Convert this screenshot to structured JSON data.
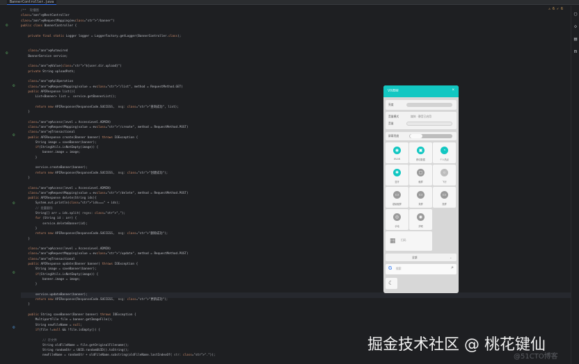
{
  "editor": {
    "tab_label": "BannerController.java",
    "status_text": "⚠ 6  ✓ 6",
    "code_lines": [
      "/**  轮播图",
      "@RestController",
      "@RequestMapping(⊕∨\"/banner\")",
      "public class BannerController {",
      "",
      "    private final static Logger logger = LoggerFactory.getLogger(BannerController.class);",
      "",
      "",
      "    @Autowired",
      "    BannerService service;",
      "",
      "    @Value(\"${user.dir.upload}\")",
      "    private String uploadPath;",
      "",
      "    @ApiOperation",
      "    @RequestMapping(value = ⊕∨\"/list\", method = RequestMethod.GET)",
      "    public APIResponse list(){",
      "        List<Banner> list =  service.getBannerList();",
      "",
      "        return new APIResponse(ResponseCode.SUCCESS,  msg: \"查询成功\", list);",
      "    }",
      "",
      "    @Access(level = AccessLevel.ADMIN)",
      "    @RequestMapping(value = ⊕∨\"/create\", method = RequestMethod.POST)",
      "    @Transactional",
      "    public APIResponse create(Banner banner) throws IOException {",
      "        String image = saveBanner(banner);",
      "        if(StringUtils.isNotEmpty(image)) {",
      "            banner.image = image;",
      "        }",
      "",
      "        service.createBanner(banner);",
      "        return new APIResponse(ResponseCode.SUCCESS,  msg: \"创建成功\");",
      "    }",
      "",
      "    @Access(level = AccessLevel.ADMIN)",
      "    @RequestMapping(value = ⊕∨\"/delete\", method = RequestMethod.POST)",
      "    public APIResponse delete(String ids){",
      "        System.out.println(\"ids===\" + ids);",
      "        // 批量删除",
      "        String[] arr = ids.split( regex: \",\");",
      "        for (String id : arr) {",
      "            service.deleteBanner(id);",
      "        }",
      "        return new APIResponse(ResponseCode.SUCCESS,  msg: \"删除成功\");",
      "    }",
      "",
      "    @Access(level = AccessLevel.ADMIN)",
      "    @RequestMapping(value = ⊕∨\"/update\", method = RequestMethod.POST)",
      "    @Transactional",
      "    public APIResponse update(Banner banner) throws IOException {",
      "        String image = saveBanner(banner);",
      "        if(StringUtils.isNotEmpty(image)) {",
      "            banner.image = image;",
      "        }",
      "",
      "        service.updateBanner(banner);",
      "        return new APIResponse(ResponseCode.SUCCESS,  msg: \"更新成功\");",
      "    }",
      "",
      "    public String saveBanner(Banner banner) throws IOException {",
      "        MultipartFile file = banner.getImageFile();",
      "        String newFileName = null;",
      "        if(file !=null && !file.isEmpty()) {",
      "",
      "            // 存文件",
      "            String oldFileName = file.getOriginalFilename();",
      "            String randomStr = UUID.randomUUID().toString();",
      "            newFileName = randomStr + oldFileName.substring(oldFileName.lastIndexOf( str: \".\"));"
    ]
  },
  "phone": {
    "title": "VIVBM",
    "close": "×",
    "row1_label": "亮度",
    "row2_label": "音量模式",
    "row2_value": "媒体 · 静音已启用",
    "row3_label": "音量",
    "row4_label": "屏幕亮度",
    "tiles": [
      {
        "label": "WLAN",
        "icon": "◉",
        "color": "#12c7c2"
      },
      {
        "label": "移动数据",
        "icon": "▣",
        "color": "#12c7c2"
      },
      {
        "label": "个人热点",
        "icon": "◔",
        "color": "#12c7c2"
      },
      {
        "label": "蓝牙",
        "icon": "✱",
        "color": "#12c7c2"
      },
      {
        "label": "截屏",
        "icon": "▢",
        "color": "#9a9a9a"
      },
      {
        "label": "飞行",
        "icon": "○",
        "color": "#bdbdbd"
      },
      {
        "label": "超级截屏",
        "icon": "▭",
        "color": "#9a9a9a"
      },
      {
        "label": "录屏",
        "icon": "▭",
        "color": "#9a9a9a"
      },
      {
        "label": "投屏",
        "icon": "▭",
        "color": "#9a9a9a"
      },
      {
        "label": "手电",
        "icon": "◎",
        "color": "#9a9a9a"
      },
      {
        "label": "护眼",
        "icon": "◉",
        "color": "#9a9a9a"
      }
    ],
    "wide_tile_label": "扫码",
    "select_label": "全部",
    "search_text": "搜索",
    "accent": "#12c7c2"
  },
  "watermark": {
    "main": "掘金技术社区 @ 桃花键仙",
    "sub": "@51CTO博客"
  }
}
